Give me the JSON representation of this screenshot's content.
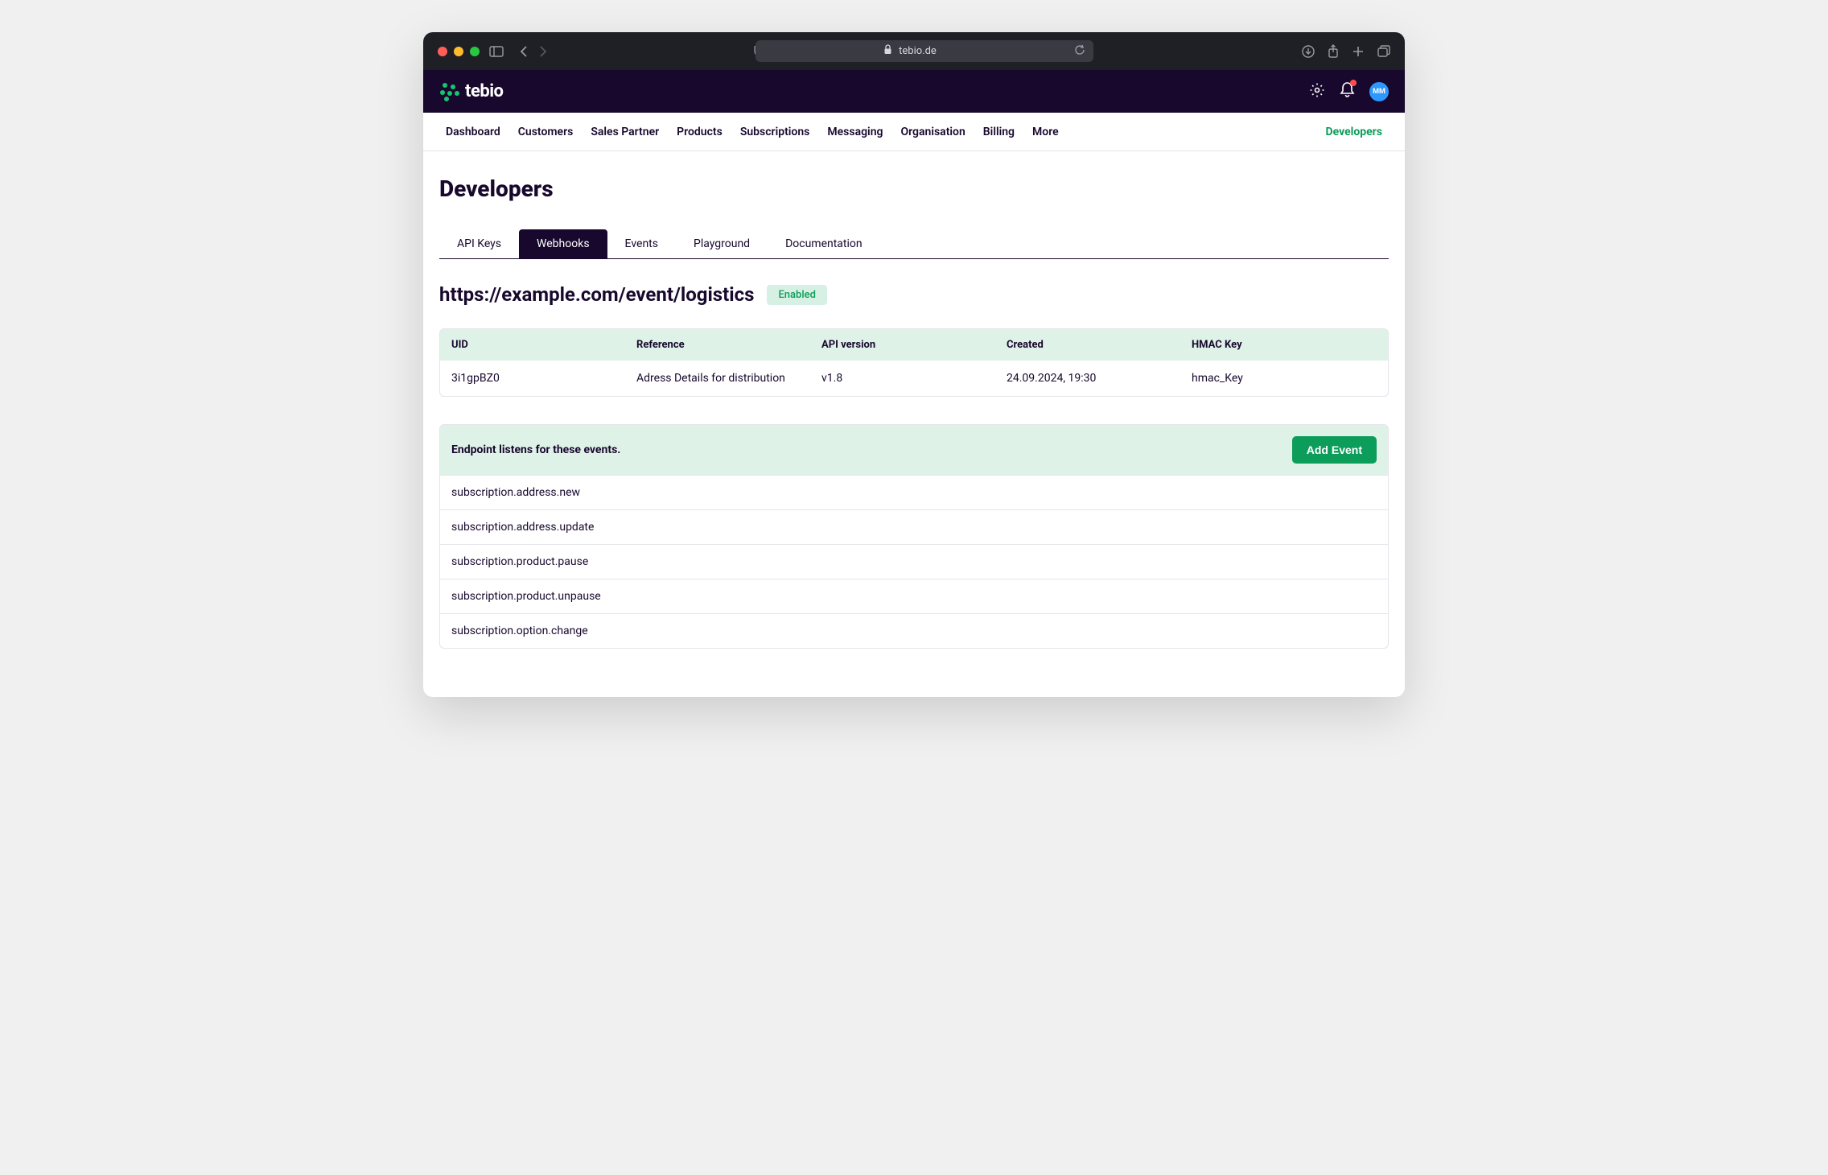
{
  "browser": {
    "url": "tebio.de"
  },
  "app": {
    "logo_text": "tebio",
    "avatar_initials": "MM"
  },
  "nav": {
    "items": [
      "Dashboard",
      "Customers",
      "Sales Partner",
      "Products",
      "Subscriptions",
      "Messaging",
      "Organisation",
      "Billing",
      "More"
    ],
    "developers": "Developers"
  },
  "page": {
    "title": "Developers"
  },
  "tabs": {
    "items": [
      "API Keys",
      "Webhooks",
      "Events",
      "Playground",
      "Documentation"
    ],
    "active_index": 1
  },
  "webhook": {
    "endpoint": "https://example.com/event/logistics",
    "status": "Enabled",
    "columns": [
      "UID",
      "Reference",
      "API version",
      "Created",
      "HMAC Key"
    ],
    "row": {
      "uid": "3i1gpBZ0",
      "reference": "Adress Details for distribution",
      "api_version": "v1.8",
      "created": "24.09.2024, 19:30",
      "hmac_key": "hmac_Key"
    }
  },
  "events": {
    "title": "Endpoint listens for these events.",
    "add_button": "Add Event",
    "list": [
      "subscription.address.new",
      "subscription.address.update",
      "subscription.product.pause",
      "subscription.product.unpause",
      "subscription.option.change"
    ]
  }
}
